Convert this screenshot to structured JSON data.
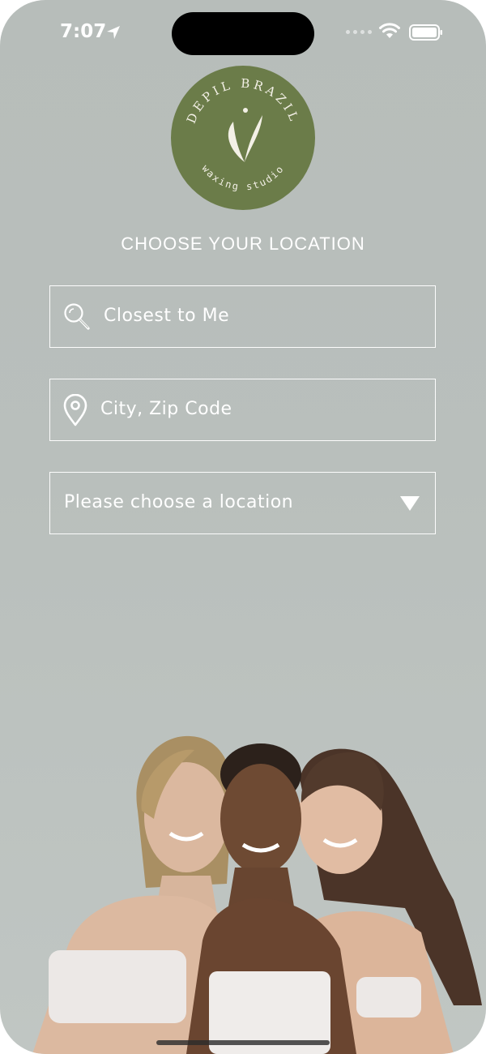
{
  "status_bar": {
    "time": "7:07"
  },
  "logo": {
    "brand": "DEPIL BRAZIL",
    "tagline": "waxing studio",
    "color": "#6b7c49"
  },
  "title": "CHOOSE YOUR LOCATION",
  "closest": {
    "label": "Closest to Me",
    "icon": "search-icon"
  },
  "city_zip": {
    "placeholder": "City, Zip Code",
    "icon": "map-pin-icon"
  },
  "location_select": {
    "selected": "Please choose a location",
    "icon": "dropdown-triangle-icon"
  },
  "colors": {
    "background": "#b8beba",
    "text": "#ffffff",
    "logo_green": "#6b7c49"
  }
}
